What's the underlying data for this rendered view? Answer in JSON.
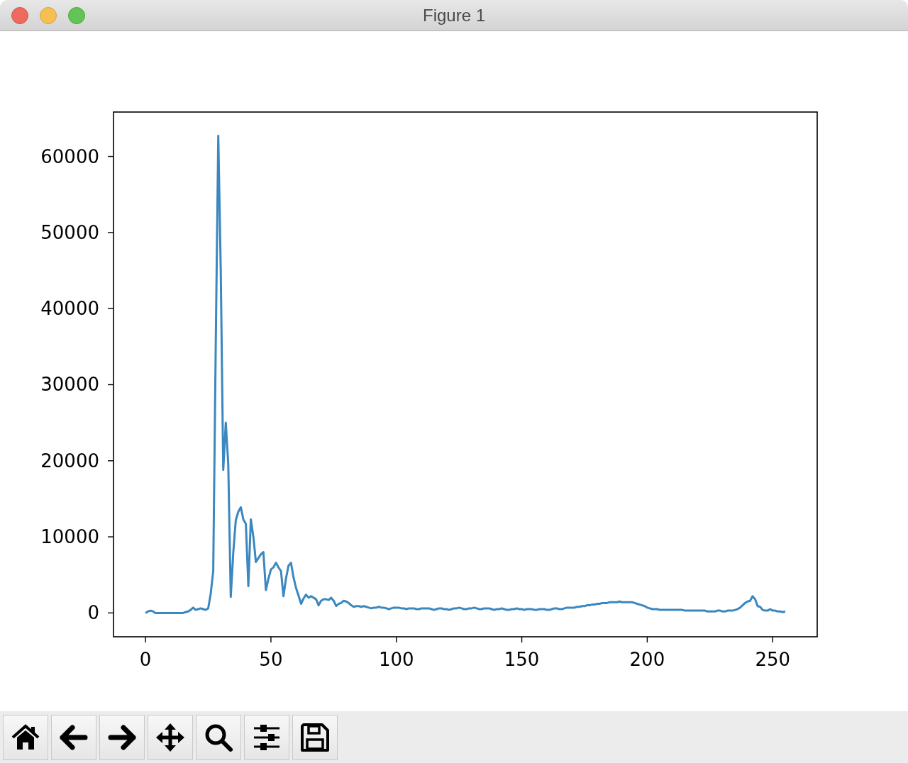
{
  "window": {
    "title": "Figure 1"
  },
  "figure": {
    "chart_data": {
      "type": "line",
      "x": [
        0,
        1,
        2,
        3,
        4,
        5,
        6,
        7,
        8,
        9,
        10,
        11,
        12,
        13,
        14,
        15,
        16,
        17,
        18,
        19,
        20,
        21,
        22,
        23,
        24,
        25,
        26,
        27,
        28,
        29,
        30,
        31,
        32,
        33,
        34,
        35,
        36,
        37,
        38,
        39,
        40,
        41,
        42,
        43,
        44,
        45,
        46,
        47,
        48,
        49,
        50,
        51,
        52,
        53,
        54,
        55,
        56,
        57,
        58,
        59,
        60,
        61,
        62,
        63,
        64,
        65,
        66,
        67,
        68,
        69,
        70,
        71,
        72,
        73,
        74,
        75,
        76,
        77,
        78,
        79,
        80,
        81,
        82,
        83,
        84,
        85,
        86,
        87,
        88,
        89,
        90,
        91,
        92,
        93,
        94,
        95,
        96,
        97,
        98,
        99,
        100,
        101,
        102,
        103,
        104,
        105,
        106,
        107,
        108,
        109,
        110,
        111,
        112,
        113,
        114,
        115,
        116,
        117,
        118,
        119,
        120,
        121,
        122,
        123,
        124,
        125,
        126,
        127,
        128,
        129,
        130,
        131,
        132,
        133,
        134,
        135,
        136,
        137,
        138,
        139,
        140,
        141,
        142,
        143,
        144,
        145,
        146,
        147,
        148,
        149,
        150,
        151,
        152,
        153,
        154,
        155,
        156,
        157,
        158,
        159,
        160,
        161,
        162,
        163,
        164,
        165,
        166,
        167,
        168,
        169,
        170,
        171,
        172,
        173,
        174,
        175,
        176,
        177,
        178,
        179,
        180,
        181,
        182,
        183,
        184,
        185,
        186,
        187,
        188,
        189,
        190,
        191,
        192,
        193,
        194,
        195,
        196,
        197,
        198,
        199,
        200,
        201,
        202,
        203,
        204,
        205,
        206,
        207,
        208,
        209,
        210,
        211,
        212,
        213,
        214,
        215,
        216,
        217,
        218,
        219,
        220,
        221,
        222,
        223,
        224,
        225,
        226,
        227,
        228,
        229,
        230,
        231,
        232,
        233,
        234,
        235,
        236,
        237,
        238,
        239,
        240,
        241,
        242,
        243,
        244,
        245,
        246,
        247,
        248,
        249,
        250,
        251,
        252,
        253,
        254,
        255
      ],
      "series": [
        {
          "color": "#3b87bf",
          "values": [
            0,
            200,
            300,
            200,
            0,
            0,
            0,
            0,
            0,
            0,
            0,
            0,
            0,
            0,
            0,
            0,
            100,
            200,
            400,
            700,
            400,
            500,
            600,
            500,
            400,
            600,
            2500,
            5500,
            35000,
            62700,
            45000,
            18800,
            25000,
            19500,
            2100,
            8000,
            12200,
            13300,
            13900,
            12300,
            11700,
            3500,
            12300,
            10000,
            6700,
            7200,
            7700,
            8000,
            3000,
            4500,
            5700,
            6000,
            6600,
            6000,
            5500,
            2200,
            4500,
            6200,
            6600,
            4700,
            3300,
            2300,
            1200,
            1900,
            2400,
            2000,
            2200,
            2000,
            1800,
            1000,
            1600,
            1800,
            1800,
            1700,
            2000,
            1600,
            900,
            1200,
            1300,
            1600,
            1500,
            1300,
            1000,
            800,
            900,
            900,
            800,
            900,
            800,
            700,
            600,
            700,
            700,
            800,
            700,
            700,
            600,
            500,
            600,
            700,
            700,
            700,
            600,
            600,
            500,
            600,
            600,
            600,
            500,
            500,
            600,
            600,
            600,
            600,
            500,
            400,
            500,
            600,
            600,
            500,
            500,
            400,
            500,
            600,
            600,
            700,
            600,
            500,
            500,
            600,
            600,
            700,
            600,
            500,
            500,
            600,
            600,
            600,
            500,
            400,
            500,
            500,
            600,
            500,
            400,
            400,
            500,
            500,
            600,
            500,
            500,
            400,
            500,
            500,
            500,
            400,
            400,
            500,
            500,
            500,
            400,
            400,
            500,
            600,
            600,
            500,
            500,
            600,
            700,
            700,
            700,
            700,
            800,
            800,
            900,
            900,
            1000,
            1000,
            1100,
            1100,
            1200,
            1200,
            1300,
            1300,
            1300,
            1400,
            1400,
            1400,
            1400,
            1500,
            1400,
            1400,
            1400,
            1400,
            1400,
            1300,
            1200,
            1100,
            1000,
            900,
            700,
            600,
            500,
            500,
            500,
            400,
            400,
            400,
            400,
            400,
            400,
            400,
            400,
            400,
            400,
            300,
            300,
            300,
            300,
            300,
            300,
            300,
            300,
            300,
            200,
            200,
            200,
            200,
            300,
            300,
            200,
            200,
            300,
            300,
            300,
            400,
            500,
            700,
            1000,
            1300,
            1500,
            1600,
            2200,
            1800,
            900,
            800,
            400,
            300,
            300,
            500,
            300,
            300,
            200,
            200,
            100,
            200
          ]
        }
      ],
      "xlim": [
        -12.75,
        267.75
      ],
      "ylim": [
        -3135,
        65835
      ],
      "xticks": [
        0,
        50,
        100,
        150,
        200,
        250
      ],
      "yticks": [
        0,
        10000,
        20000,
        30000,
        40000,
        50000,
        60000
      ]
    }
  },
  "toolbar": [
    {
      "kind": "home"
    },
    {
      "kind": "back"
    },
    {
      "kind": "forward"
    },
    {
      "kind": "pan"
    },
    {
      "kind": "zoom"
    },
    {
      "kind": "configure"
    },
    {
      "kind": "save"
    }
  ]
}
